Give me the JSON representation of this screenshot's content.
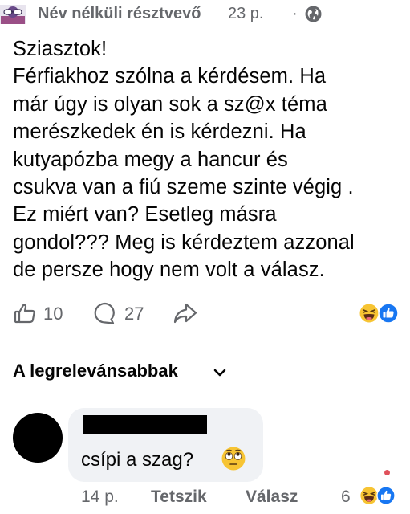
{
  "post": {
    "author": "Név nélküli résztvevő",
    "time": "23 p.",
    "separator": "·",
    "privacy_icon": "globe-icon",
    "text": "Sziasztok!\nFérfiakhoz szólna a kérdésem. Ha\nmár úgy is olyan sok a sz@x téma\nmerészkedek én is kérdezni. Ha\nkutyapózba megy a hancur és\ncsukva van a fiú szeme szinte végig .\nEz miért van? Esetleg másra\ngondol??? Meg is kérdeztem azzonal\nde persze hogy nem volt a válasz.",
    "likes": "10",
    "comments": "27",
    "reactions": [
      "laughing-emoji",
      "like-reaction"
    ]
  },
  "sort": {
    "label": "A legrelevánsabbak"
  },
  "comment": {
    "text": "csípi a szag?",
    "emoji": "rolling-eyes-emoji",
    "time": "14 p.",
    "like_label": "Tetszik",
    "reply_label": "Válasz",
    "reaction_count": "6"
  },
  "colors": {
    "text": "#050505",
    "muted": "#65676b",
    "bubble": "#f0f2f5",
    "like_blue": "#1877f2",
    "emoji_yellow": "#f7c433"
  }
}
